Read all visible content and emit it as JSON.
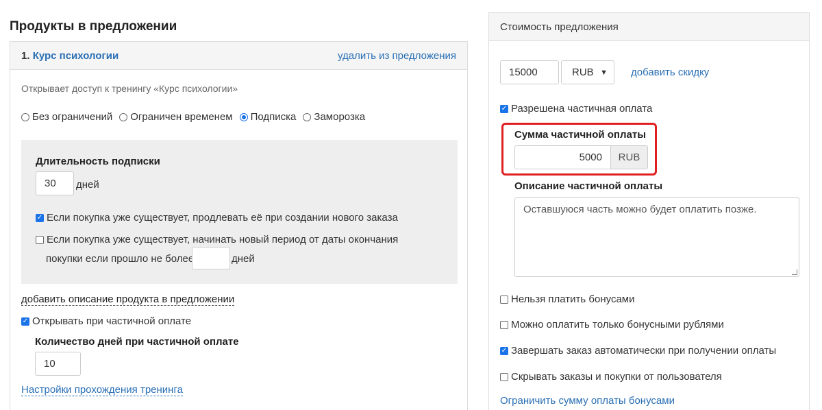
{
  "page_title": "Продукты в предложении",
  "product": {
    "number": "1.",
    "name": "Курс психологии",
    "remove_label": "удалить из предложения",
    "access_text": "Открывает доступ к тренингу «Курс психологии»",
    "access_options": [
      {
        "label": "Без ограничений",
        "checked": false
      },
      {
        "label": "Ограничен временем",
        "checked": false
      },
      {
        "label": "Подписка",
        "checked": true
      },
      {
        "label": "Заморозка",
        "checked": false
      }
    ],
    "subscription": {
      "duration_label": "Длительность подписки",
      "duration_value": "30",
      "days_word": "дней",
      "extend_label": "Если покупка уже существует, продлевать её при создании нового заказа",
      "extend_checked": true,
      "new_period_label_1": "Если покупка уже существует, начинать новый период от даты окончания",
      "new_period_label_2": "покупки если прошло не более",
      "new_period_checked": false,
      "new_period_value": "",
      "new_period_days_word": "дней"
    },
    "add_description_label": "добавить описание продукта в предложении",
    "partial_open_label": "Открывать при частичной оплате",
    "partial_open_checked": true,
    "partial_days_label": "Количество дней при частичной оплате",
    "partial_days_value": "10",
    "training_settings_label": "Настройки прохождения тренинга"
  },
  "cost": {
    "header": "Стоимость предложения",
    "price_value": "15000",
    "currency": "RUB",
    "add_discount_label": "добавить скидку",
    "partial_allowed_label": "Разрешена частичная оплата",
    "partial_allowed_checked": true,
    "partial_sum_label": "Сумма частичной оплаты",
    "partial_sum_value": "5000",
    "partial_sum_currency": "RUB",
    "partial_desc_label": "Описание частичной оплаты",
    "partial_desc_value": "Оставшуюся часть можно будет оплатить позже.",
    "options": {
      "no_bonus": {
        "label": "Нельзя платить бонусами",
        "checked": false
      },
      "only_bonus": {
        "label": "Можно оплатить только бонусными рублями",
        "checked": false
      },
      "auto_complete": {
        "label": "Завершать заказ автоматически при получении оплаты",
        "checked": true
      },
      "hide_orders": {
        "label": "Скрывать заказы и покупки от пользователя",
        "checked": false
      }
    },
    "limit_bonus_label": "Ограничить сумму оплаты бонусами"
  },
  "colors": {
    "link": "#2a6fb4",
    "checkbox_accent": "#1a73e8",
    "highlight_border": "#e02020",
    "panel_header_bg": "#f5f5f5",
    "subscription_box_bg": "#eeeeee"
  }
}
